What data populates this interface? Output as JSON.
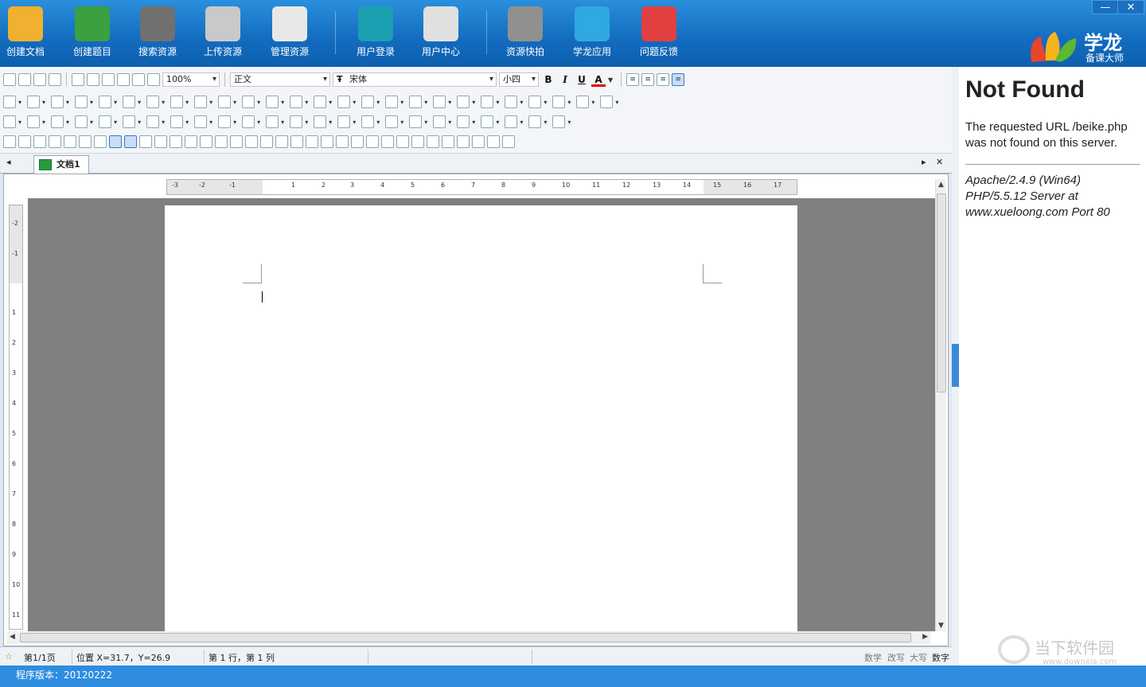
{
  "window": {
    "min_label": "—",
    "close_label": "✕"
  },
  "topbar": {
    "buttons": [
      {
        "label": "创建文档",
        "color": "#f0b030"
      },
      {
        "label": "创建题目",
        "color": "#3aa040"
      },
      {
        "label": "搜索资源",
        "color": "#707070"
      },
      {
        "label": "上传资源",
        "color": "#c9c9c9"
      },
      {
        "label": "管理资源",
        "color": "#e8e8e8"
      },
      {
        "label": "用户登录",
        "color": "#1aa0b0"
      },
      {
        "label": "用户中心",
        "color": "#e0e0e0"
      },
      {
        "label": "资源快拍",
        "color": "#909090"
      },
      {
        "label": "学龙应用",
        "color": "#30a8e0"
      },
      {
        "label": "问题反馈",
        "color": "#e04040"
      }
    ],
    "logo": {
      "title": "学龙",
      "subtitle": "备课大师"
    }
  },
  "toolbar": {
    "zoom": "100%",
    "style": "正文",
    "font": "宋体",
    "font_icon": "Ŧ",
    "size": "小四",
    "bold": "B",
    "italic": "I",
    "underline": "U",
    "font_color": "A"
  },
  "tabs": {
    "doc": "文档1",
    "left": "◂",
    "right": "▸",
    "close": "✕"
  },
  "ruler": {
    "h": [
      "-3",
      "-2",
      "-1",
      "1",
      "2",
      "3",
      "4",
      "5",
      "6",
      "7",
      "8",
      "9",
      "10",
      "11",
      "12",
      "13",
      "14",
      "15",
      "16",
      "17"
    ],
    "v": [
      "-2",
      "-1",
      "1",
      "2",
      "3",
      "4",
      "5",
      "6",
      "7",
      "8",
      "9",
      "10",
      "11"
    ]
  },
  "status": {
    "page": "第1/1页",
    "position": "位置 X=31.7，Y=26.9",
    "rowcol": "第 1 行，第 1 列",
    "flags": [
      "数学",
      "改写",
      "大写",
      "数字"
    ]
  },
  "bottombar": {
    "version": "程序版本：20120222"
  },
  "rightpanel": {
    "title": "Not Found",
    "message": "The requested URL /beike.php was not found on this server.",
    "address": "Apache/2.4.9 (Win64) PHP/5.5.12 Server at www.xueloong.com Port 80"
  },
  "watermark": {
    "text": "当下软件园",
    "url": "www.downxia.com"
  }
}
